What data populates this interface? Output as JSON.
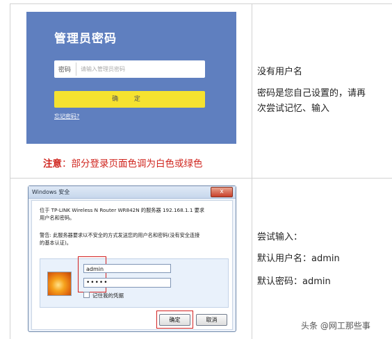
{
  "panel1": {
    "title": "管理员密码",
    "pwd_label": "密码",
    "pwd_placeholder": "请输入管理员密码",
    "confirm_label": "确 定",
    "forgot_label": "忘记密码?",
    "note_prefix": "注意",
    "note_text": "：部分登录页面色调为白色或绿色",
    "right_line1": "没有用户名",
    "right_line2a": "密码是您自己设置的，请再",
    "right_line2b": "次尝试记忆、输入"
  },
  "panel2": {
    "title": "Windows 安全",
    "close_label": "x",
    "msg_line1": "位于 TP-LINK Wireless N Router WR842N 的服务器 192.168.1.1 要求",
    "msg_line2": "用户名和密码。",
    "warn_line1": "警告: 此服务器要求以不安全的方式发送您的用户名和密码(没有安全连接",
    "warn_line2": "的基本认证)。",
    "username_value": "admin",
    "password_mask": "•••••",
    "remember_label": "记住我的凭据",
    "ok_label": "确定",
    "cancel_label": "取消",
    "right_line1": "尝试输入：",
    "right_line2": "默认用户名：admin",
    "right_line3": "默认密码：admin"
  },
  "watermark": "头条 @网工那些事"
}
